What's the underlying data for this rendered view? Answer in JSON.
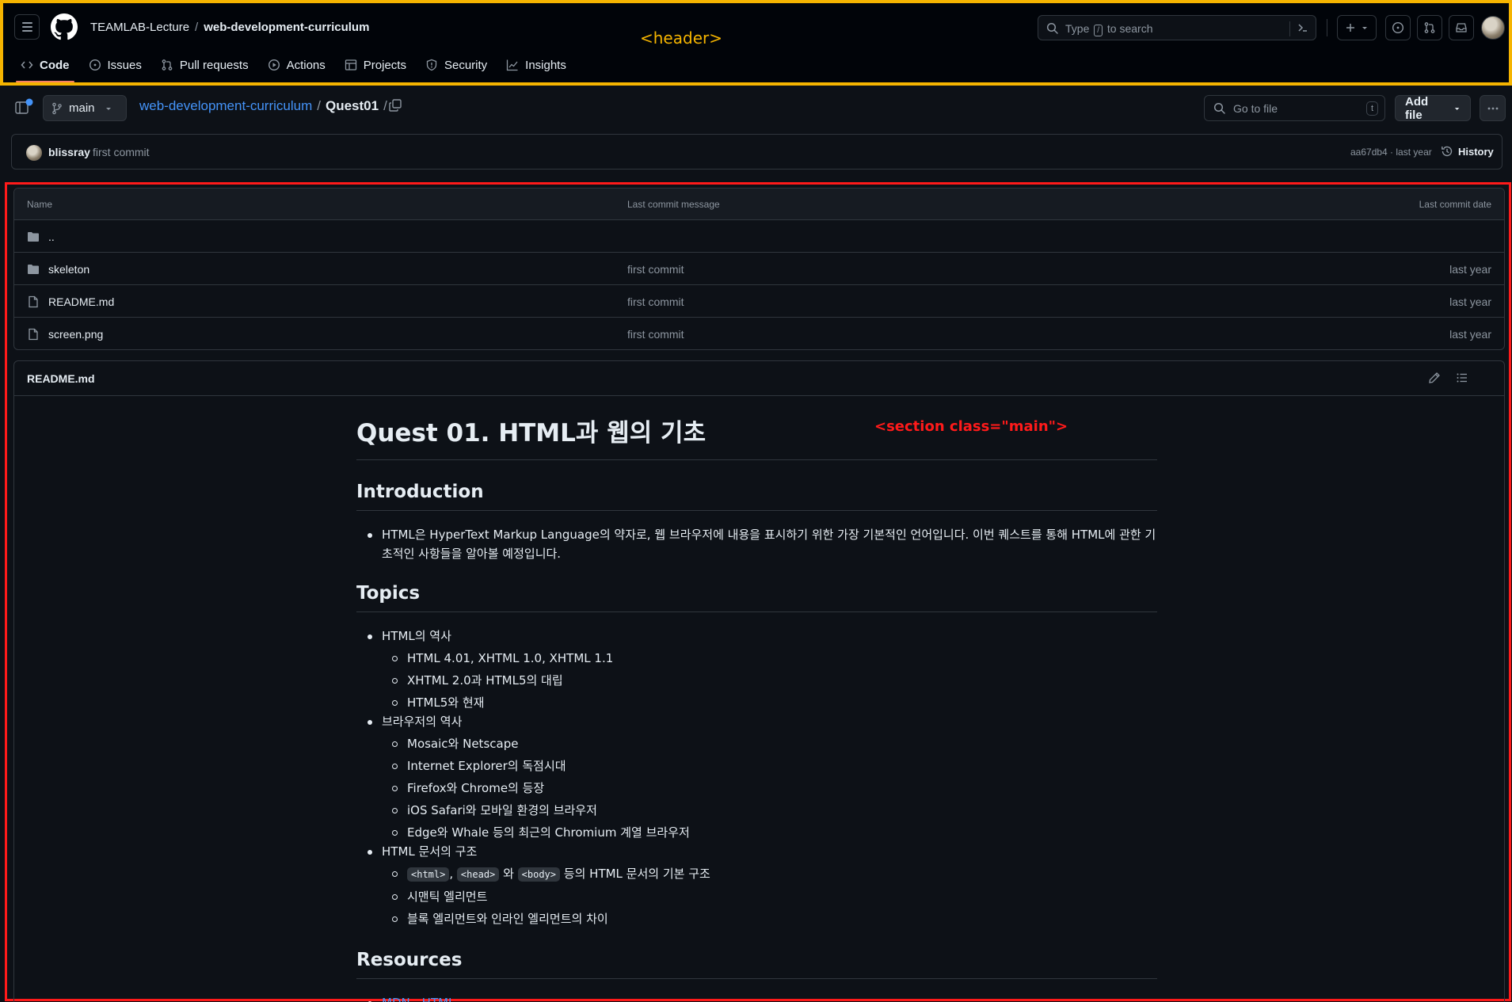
{
  "header": {
    "owner": "TEAMLAB-Lecture",
    "separator": "/",
    "repo": "web-development-curriculum",
    "annotation": "<header>",
    "search_placeholder_pre": "Type",
    "search_placeholder_key": "/",
    "search_placeholder_post": "to search",
    "nav": [
      {
        "label": "Code",
        "icon": "code-icon",
        "active": true
      },
      {
        "label": "Issues",
        "icon": "issue-icon"
      },
      {
        "label": "Pull requests",
        "icon": "pull-request-icon"
      },
      {
        "label": "Actions",
        "icon": "play-icon"
      },
      {
        "label": "Projects",
        "icon": "table-icon"
      },
      {
        "label": "Security",
        "icon": "shield-icon"
      },
      {
        "label": "Insights",
        "icon": "graph-icon"
      }
    ]
  },
  "toolbar": {
    "branch": "main",
    "path_repo": "web-development-curriculum",
    "path_sep": "/",
    "path_current": "Quest01",
    "path_trailing": "/",
    "goto_placeholder": "Go to file",
    "goto_key": "t",
    "add_file": "Add file"
  },
  "commit": {
    "author": "blissray",
    "message": "first commit",
    "sha_time": "aa67db4 · last year",
    "history": "History"
  },
  "files": {
    "headers": {
      "name": "Name",
      "message": "Last commit message",
      "date": "Last commit date"
    },
    "parent": "..",
    "rows": [
      {
        "name": "skeleton",
        "type": "folder",
        "message": "first commit",
        "date": "last year"
      },
      {
        "name": "README.md",
        "type": "file",
        "message": "first commit",
        "date": "last year"
      },
      {
        "name": "screen.png",
        "type": "file",
        "message": "first commit",
        "date": "last year"
      }
    ]
  },
  "readme": {
    "title": "README.md",
    "annotation": "<section class=\"main\">",
    "h1": "Quest 01. HTML과 웹의 기초",
    "intro_h": "Introduction",
    "intro_text": "HTML은 HyperText Markup Language의 약자로, 웹 브라우저에 내용을 표시하기 위한 가장 기본적인 언어입니다. 이번 퀘스트를 통해 HTML에 관한 기초적인 사항들을 알아볼 예정입니다.",
    "topics_h": "Topics",
    "topics": [
      {
        "label": "HTML의 역사",
        "children": [
          "HTML 4.01, XHTML 1.0, XHTML 1.1",
          "XHTML 2.0과 HTML5의 대립",
          "HTML5와 현재"
        ]
      },
      {
        "label": "브라우저의 역사",
        "children": [
          "Mosaic와 Netscape",
          "Internet Explorer의 독점시대",
          "Firefox와 Chrome의 등장",
          "iOS Safari와 모바일 환경의 브라우저",
          "Edge와 Whale 등의 최근의 Chromium 계열 브라우저"
        ]
      },
      {
        "label": "HTML 문서의 구조"
      }
    ],
    "structure_code1": "<html>",
    "structure_comma": ",",
    "structure_code2": "<head>",
    "structure_and": "와",
    "structure_code3": "<body>",
    "structure_tail": "등의 HTML 문서의 기본 구조",
    "structure_item2": "시맨틱 엘리먼트",
    "structure_item3": "블록 엘리먼트와 인라인 엘리먼트의 차이",
    "resources_h": "Resources",
    "resources": [
      "MDN - HTML"
    ]
  }
}
